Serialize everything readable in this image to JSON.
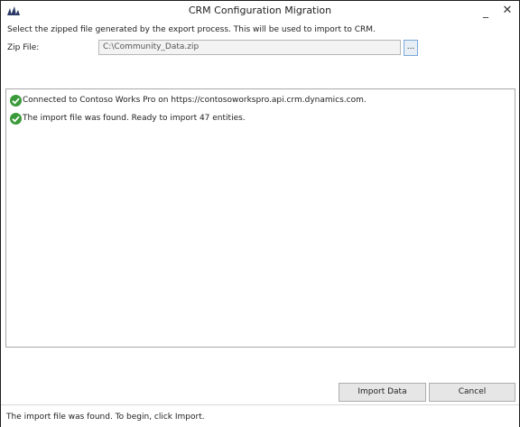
{
  "window": {
    "title": "CRM Configuration Migration",
    "minimize_glyph": "_",
    "close_glyph": "✕",
    "app_icon": "dynamics-logo-icon"
  },
  "form": {
    "instruction": "Select the zipped file generated by the export process. This will be used to import to CRM.",
    "zip_label": "Zip File:",
    "zip_value": "C:\\Community_Data.zip",
    "browse_label": "..."
  },
  "log": {
    "entries": [
      {
        "icon": "success-check-icon",
        "text": "Connected to Contoso Works Pro on https://contosoworkspro.api.crm.dynamics.com."
      },
      {
        "icon": "success-check-icon",
        "text": "The import file was found. Ready to import 47 entities."
      }
    ]
  },
  "buttons": {
    "import_label": "Import Data",
    "cancel_label": "Cancel"
  },
  "status": {
    "text": "The import file was found. To begin, click Import."
  },
  "colors": {
    "success": "#3a9a3a",
    "brand": "#2b3a67"
  }
}
